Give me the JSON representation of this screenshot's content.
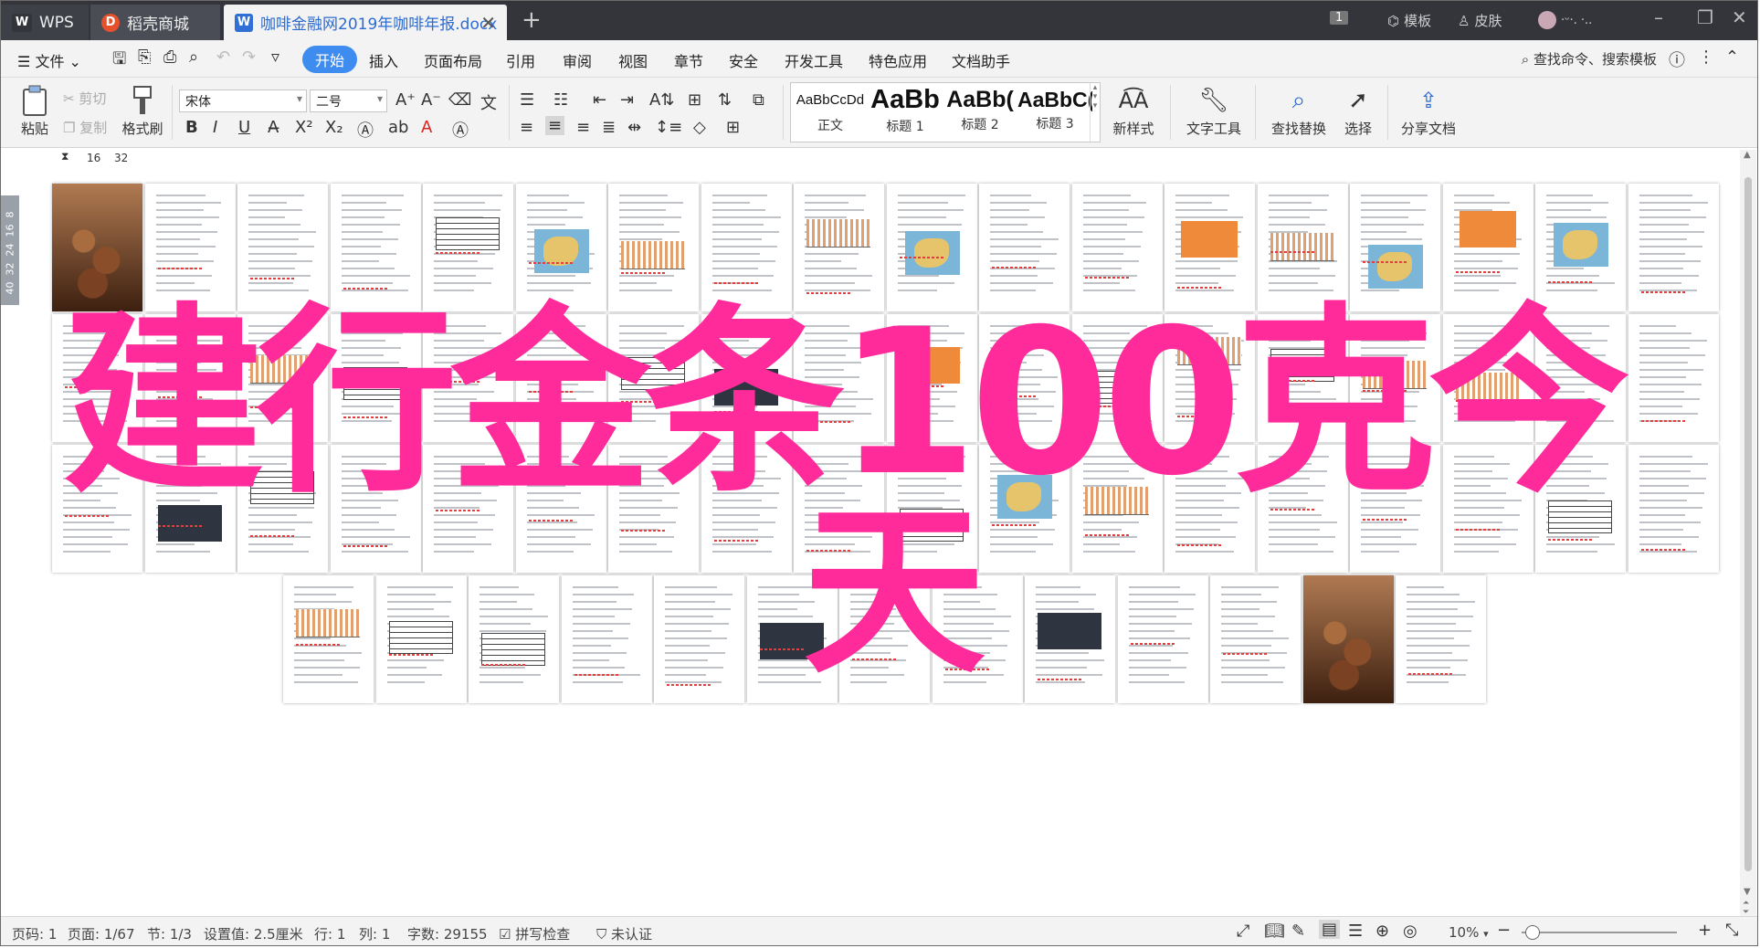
{
  "titlebar": {
    "tabs": [
      {
        "label": "WPS",
        "icon": "wps-logo-icon"
      },
      {
        "label": "稻壳商城",
        "icon": "docer-icon"
      },
      {
        "label": "咖啡金融网2019年咖啡年报.docx",
        "icon": "word-doc-icon"
      }
    ],
    "right": {
      "page_count_badge": "1",
      "template_label": "模板",
      "skin_label": "皮肤",
      "user_dots": "·ᵕ·. ·.."
    },
    "window_controls": [
      "minimize",
      "restore",
      "close"
    ]
  },
  "menu": {
    "file_label": "文件",
    "items": [
      "开始",
      "插入",
      "页面布局",
      "引用",
      "审阅",
      "视图",
      "章节",
      "安全",
      "开发工具",
      "特色应用",
      "文档助手"
    ],
    "active": "开始",
    "search_label": "查找命令、搜索模板"
  },
  "ribbon": {
    "paste": "粘贴",
    "cut": "剪切",
    "copy": "复制",
    "format_painter": "格式刷",
    "font_name": "宋体",
    "font_size": "二号",
    "styles": [
      {
        "sample": "AaBbCcDd",
        "name": "正文"
      },
      {
        "sample": "AaBb",
        "name": "标题 1"
      },
      {
        "sample": "AaBb(",
        "name": "标题 2"
      },
      {
        "sample": "AaBbC(",
        "name": "标题 3"
      }
    ],
    "new_style": "新样式",
    "text_tools": "文字工具",
    "find_replace": "查找替换",
    "select": "选择",
    "share_doc": "分享文档"
  },
  "ruler": {
    "top_marks": [
      "16",
      "32"
    ],
    "left_marks": [
      "8",
      "16",
      "24",
      "32",
      "40"
    ]
  },
  "watermark": {
    "line1": "建行金条100克今",
    "line2": "天"
  },
  "statusbar": {
    "page_code": "页码: 1",
    "page": "页面: 1/67",
    "section": "节: 1/3",
    "setting": "设置值: 2.5厘米",
    "row": "行: 1",
    "column": "列: 1",
    "word_count": "字数: 29155",
    "spell_check": "拼写检查",
    "certification": "未认证",
    "zoom": "10%"
  },
  "colors": {
    "accent": "#3f8cf0",
    "watermark": "#ff2b9a",
    "titlebar": "#33353b"
  }
}
